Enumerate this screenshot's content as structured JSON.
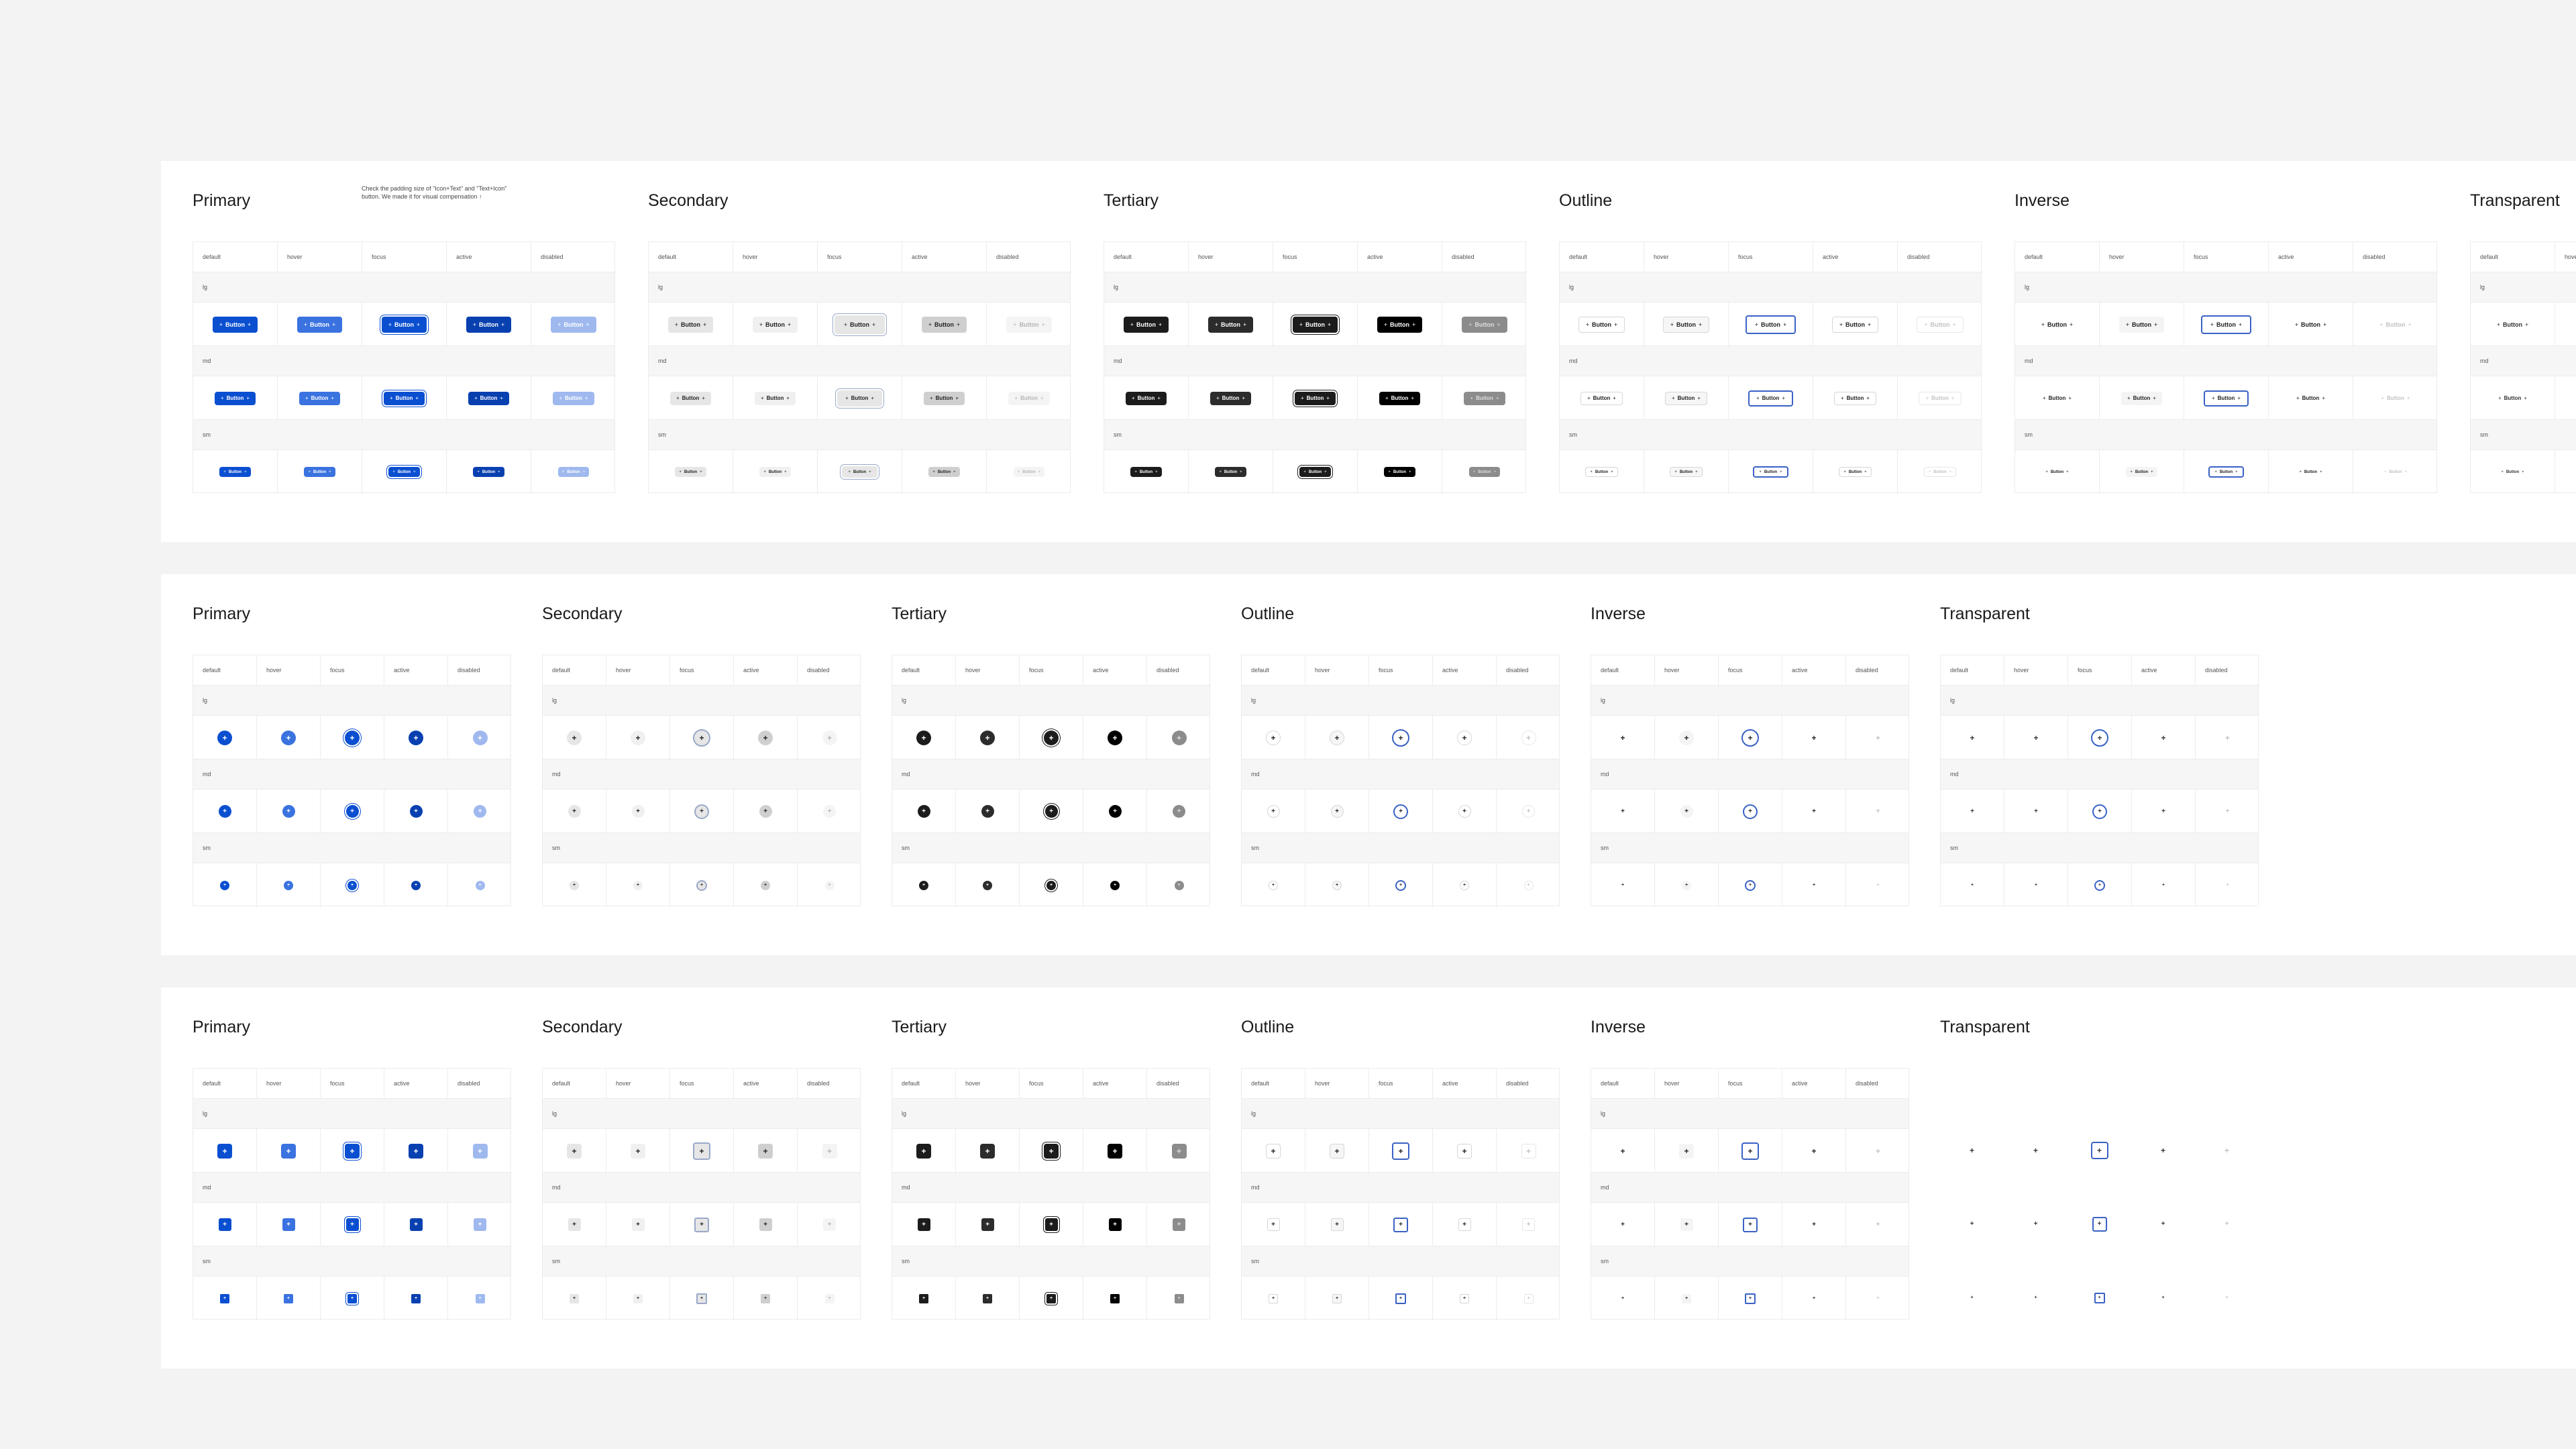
{
  "states": [
    "default",
    "hover",
    "focus",
    "active",
    "disabled"
  ],
  "sizes": [
    "lg",
    "md",
    "sm"
  ],
  "button_label": "Button",
  "plus_glyph": "+",
  "note": "Check the padding size of \"Icon+Text\" and \"Text+Icon\" button. We made it for visual compensation ↑",
  "variant_styles": {
    "primary": {
      "default": "#0b4fd1",
      "hover": "#3a72e0",
      "focus": "#0b4fd1",
      "active": "#0840b0",
      "disabled": "#9fb9ef",
      "text": "#ffffff",
      "disabled_text": "#ffffff",
      "focus_ring": "#0b4fd1"
    },
    "secondary": {
      "default": "#e6e6e6",
      "hover": "#f0f0f0",
      "focus": "#e6e6e6",
      "active": "#cfcfcf",
      "disabled": "#f4f4f4",
      "text": "#222222",
      "disabled_text": "#b5b5b5",
      "focus_ring": "#9aa9c9"
    },
    "tertiary": {
      "default": "#1c1c1c",
      "hover": "#2c2c2c",
      "focus": "#1c1c1c",
      "active": "#000000",
      "disabled": "#8c8c8c",
      "text": "#ffffff",
      "disabled_text": "#dddddd",
      "focus_ring": "#1c1c1c"
    },
    "outline": {
      "default": "#ffffff",
      "hover": "#f6f6f6",
      "focus": "#ffffff",
      "active": "#ffffff",
      "disabled": "#ffffff",
      "text": "#222222",
      "disabled_text": "#c2c2c2",
      "border": "#d6d6d6",
      "focus_ring": "#3a62c4"
    },
    "inverse": {
      "default": "#ffffff",
      "hover": "#f4f4f4",
      "focus": "#ffffff",
      "active": "#ffffff",
      "disabled": "#ffffff",
      "text": "#222222",
      "disabled_text": "#c2c2c2",
      "focus_ring": "#3a62c4"
    },
    "transparent": {
      "default": "transparent",
      "hover": "transparent",
      "focus": "transparent",
      "active": "transparent",
      "disabled": "transparent",
      "text": "#333333",
      "disabled_text": "#c2c2c2",
      "focus_ring": "#3a62c4"
    }
  },
  "rows": [
    {
      "name": "text-buttons",
      "kind": "text",
      "sections": [
        {
          "key": "primary",
          "title": "Primary",
          "note": true
        },
        {
          "key": "secondary",
          "title": "Secondary"
        },
        {
          "key": "tertiary",
          "title": "Tertiary"
        },
        {
          "key": "outline",
          "title": "Outline"
        },
        {
          "key": "inverse",
          "title": "Inverse"
        },
        {
          "key": "transparent",
          "title": "Transparent"
        }
      ]
    },
    {
      "name": "circle-icon-buttons",
      "kind": "circle",
      "sections": [
        {
          "key": "primary",
          "title": "Primary"
        },
        {
          "key": "secondary",
          "title": "Secondary"
        },
        {
          "key": "tertiary",
          "title": "Tertiary"
        },
        {
          "key": "outline",
          "title": "Outline"
        },
        {
          "key": "inverse",
          "title": "Inverse"
        },
        {
          "key": "transparent",
          "title": "Transparent"
        }
      ]
    },
    {
      "name": "square-icon-buttons",
      "kind": "square",
      "sections": [
        {
          "key": "primary",
          "title": "Primary"
        },
        {
          "key": "secondary",
          "title": "Secondary"
        },
        {
          "key": "tertiary",
          "title": "Tertiary"
        },
        {
          "key": "outline",
          "title": "Outline"
        },
        {
          "key": "inverse",
          "title": "Inverse"
        },
        {
          "key": "transparent",
          "title": "Transparent",
          "bare": true
        }
      ]
    }
  ]
}
